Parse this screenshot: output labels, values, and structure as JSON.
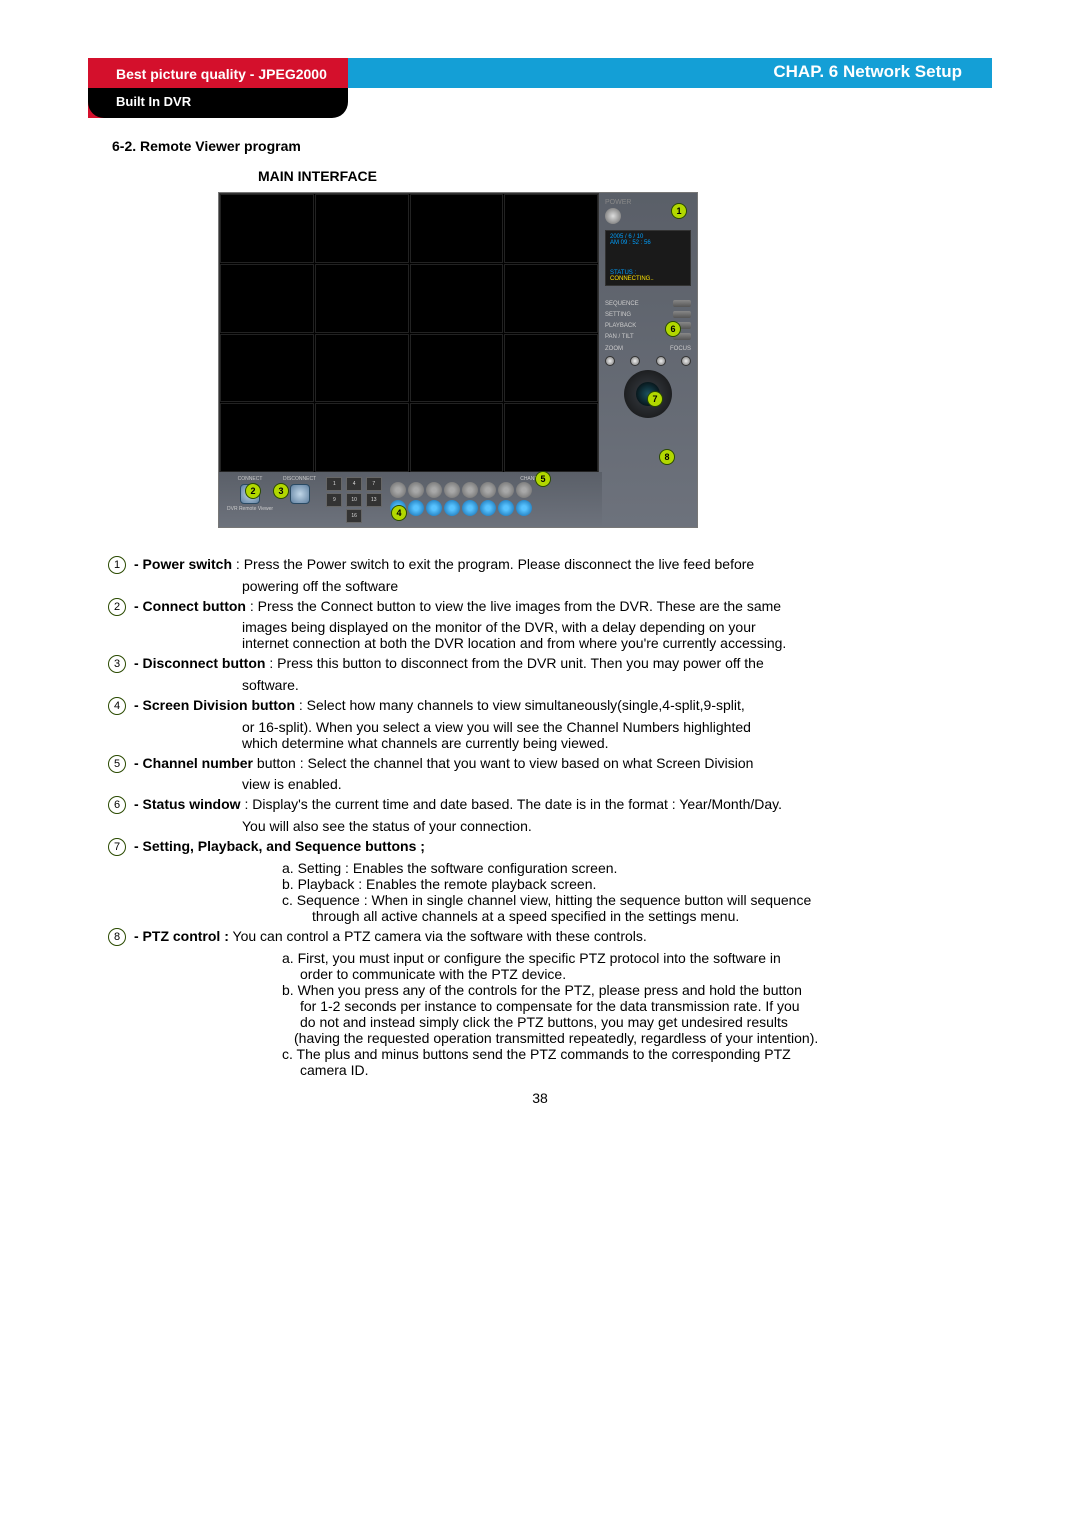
{
  "header": {
    "main_title": "Best picture quality - JPEG2000",
    "sub_title": "Built In DVR",
    "chapter": "CHAP. 6   Network Setup"
  },
  "section": {
    "title": "6-2. Remote Viewer program",
    "subtitle": "MAIN INTERFACE"
  },
  "ui_mock": {
    "power_label": "POWER",
    "date": "2005 / 6 / 10",
    "time": "AM 09 : 52 : 56",
    "status_label": "STATUS :",
    "status_value": "CONNECTING..",
    "sequence": "SEQUENCE",
    "setting": "SETTING",
    "playback": "PLAYBACK",
    "pantilt": "PAN / TILT",
    "zoom": "ZOOM",
    "focus": "FOCUS",
    "connect": "CONNECT",
    "disconnect": "DISCONNECT",
    "channel": "CHANNEL",
    "viewer_label": "DVR  Remote  Viewer",
    "div_1": "1",
    "div_4": "4",
    "div_7": "7",
    "div_9": "9",
    "div_10": "10",
    "div_13": "13",
    "div_16": "16"
  },
  "callouts": {
    "c1": "1",
    "c2": "2",
    "c3": "3",
    "c4": "4",
    "c5": "5",
    "c6": "6",
    "c7": "7",
    "c8": "8"
  },
  "items": {
    "i1": {
      "n": "1",
      "lead": "- Power switch",
      "body": " : Press the Power switch to exit the program. Please disconnect the live feed before",
      "line2": "powering off the software"
    },
    "i2": {
      "n": "2",
      "lead": "- Connect button",
      "body": " : Press the Connect button to view the live images from the DVR. These are the same",
      "line2": "images being displayed on the monitor of the DVR, with a delay depending on your",
      "line3": "internet connection at both the DVR location and from where you're currently accessing."
    },
    "i3": {
      "n": "3",
      "lead": "- Disconnect button",
      "body": " : Press this button to disconnect from the DVR unit. Then you may power off the",
      "line2": "software."
    },
    "i4": {
      "n": "4",
      "lead": "- Screen Division button",
      "body": " : Select how many channels to view simultaneously(single,4-split,9-split,",
      "line2": "or 16-split). When you select a view you will see the Channel Numbers highlighted",
      "line3": "which determine what channels are currently being viewed."
    },
    "i5": {
      "n": "5",
      "lead": "- Channel number",
      "body": " button : Select the channel that you want to view based on what Screen Division",
      "line2": "view is enabled."
    },
    "i6": {
      "n": "6",
      "lead": "- Status window",
      "body": " : Display's the current time and date based. The date is in the format : Year/Month/Day.",
      "line2": "You will also see the status of your connection."
    },
    "i7": {
      "n": "7",
      "lead": "- Setting, Playback, and Sequence buttons ;",
      "a": "a. Setting : Enables the software configuration screen.",
      "b": "b. Playback : Enables the remote playback screen.",
      "c1": "c. Sequence : When in single channel view, hitting the sequence button will sequence",
      "c2": "through all active channels at a speed specified in the settings menu."
    },
    "i8": {
      "n": "8",
      "lead": " - PTZ control :",
      "body": " You can control a PTZ camera via the software with these controls.",
      "a1": "a. First, you must input or configure the specific PTZ protocol into the software in",
      "a2": "order to communicate with the PTZ device.",
      "b1": "b. When you press any of the controls for the PTZ, please press and hold the button",
      "b2": "for 1-2 seconds per instance to compensate for the data transmission rate. If you",
      "b3": "do not and instead simply click the PTZ buttons, you may get undesired results",
      "b4": "(having the requested operation transmitted repeatedly, regardless of your intention).",
      "c1": "c. The plus and minus buttons send the PTZ commands to the corresponding PTZ",
      "c2": "camera ID."
    }
  },
  "page_number": "38"
}
